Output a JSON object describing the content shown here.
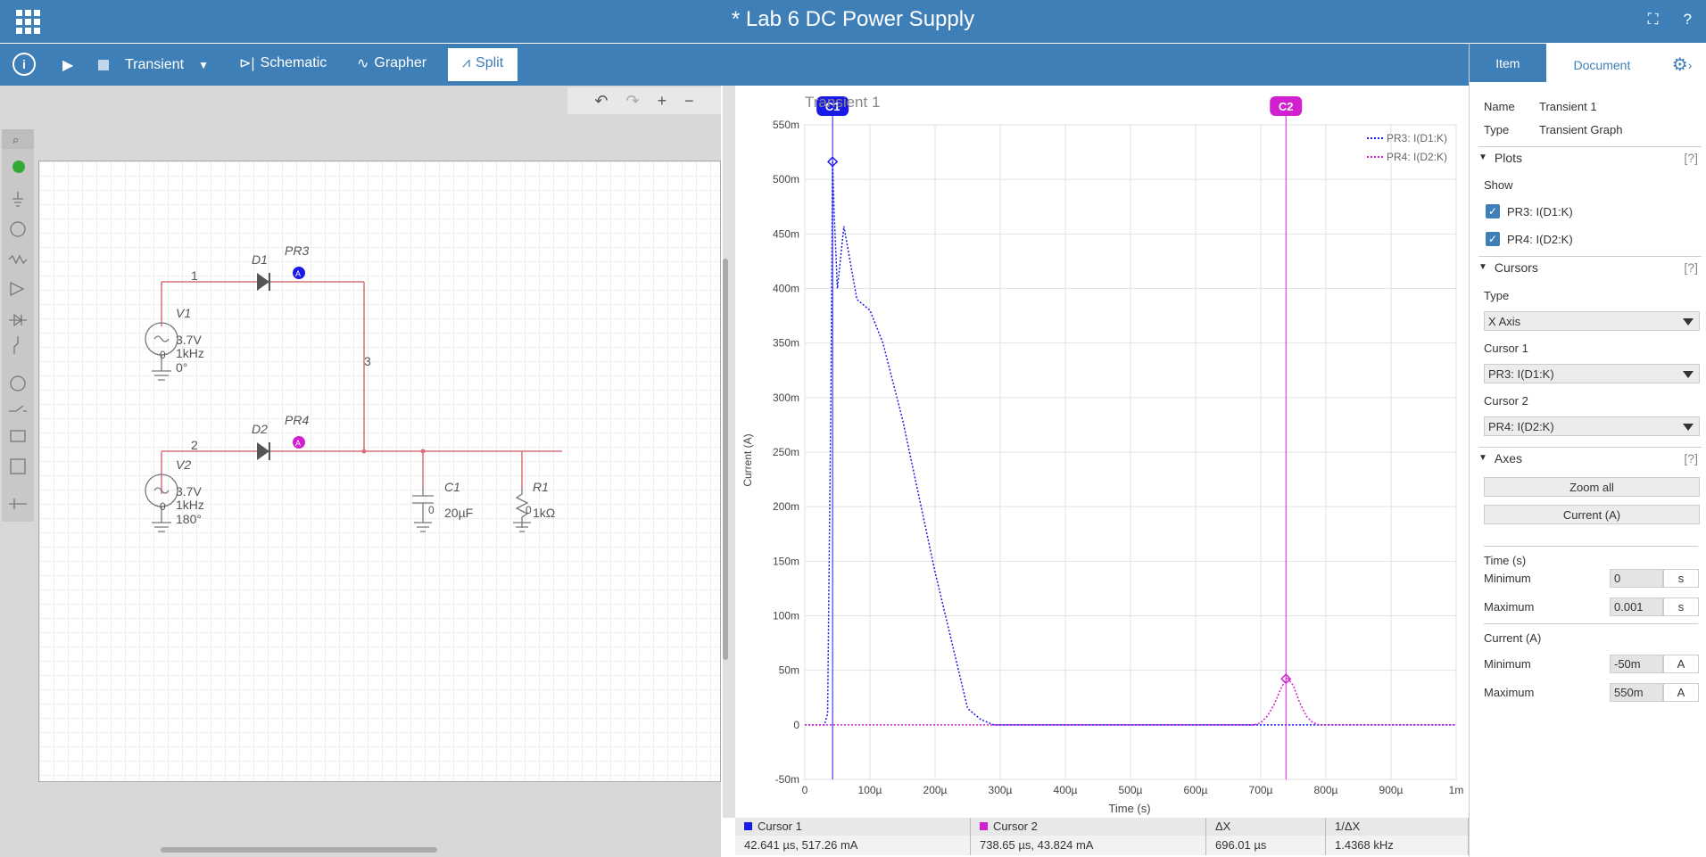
{
  "app": {
    "title": "* Lab 6 DC Power Supply"
  },
  "toolbar": {
    "mode": "Transient",
    "tabs": [
      "Schematic",
      "Grapher",
      "Split"
    ]
  },
  "panel": {
    "tabs": [
      "Item",
      "Document"
    ],
    "name_label": "Name",
    "name_value": "Transient 1",
    "type_label": "Type",
    "type_value": "Transient Graph",
    "plots_title": "Plots",
    "help": "[?]",
    "show_label": "Show",
    "plots": [
      "PR3: I(D1:K)",
      "PR4: I(D2:K)"
    ],
    "cursors_title": "Cursors",
    "cursor_type_label": "Type",
    "cursor_type_value": "X Axis",
    "cursor1_label": "Cursor 1",
    "cursor1_value": "PR3: I(D1:K)",
    "cursor2_label": "Cursor 2",
    "cursor2_value": "PR4: I(D2:K)",
    "axes_title": "Axes",
    "zoom_all": "Zoom all",
    "current_axis_btn": "Current (A)",
    "time_title": "Time (s)",
    "time_min_label": "Minimum",
    "time_min": "0",
    "time_max_label": "Maximum",
    "time_max": "0.001",
    "time_unit": "s",
    "current_title": "Current (A)",
    "cur_min_label": "Minimum",
    "cur_min": "-50m",
    "cur_max_label": "Maximum",
    "cur_max": "550m",
    "cur_unit": "A"
  },
  "schematic": {
    "labels": [
      "1",
      "2",
      "3",
      "D1",
      "D2",
      "PR3",
      "PR4",
      "V1",
      "V2",
      "C1",
      "R1",
      "3.7V",
      "1kHz",
      "0°",
      "3.7V",
      "1kHz",
      "180°",
      "20µF",
      "1kΩ",
      "0",
      "0",
      "0",
      "0"
    ]
  },
  "chart_data": {
    "type": "line",
    "title": "Transient 1",
    "xlabel": "Time (s)",
    "ylabel": "Current (A)",
    "xlim": [
      0,
      0.001
    ],
    "ylim": [
      -0.05,
      0.55
    ],
    "x_ticks": [
      "0",
      "100µ",
      "200µ",
      "300µ",
      "400µ",
      "500µ",
      "600µ",
      "700µ",
      "800µ",
      "900µ",
      "1m"
    ],
    "y_ticks": [
      "-50m",
      "0",
      "50m",
      "100m",
      "150m",
      "200m",
      "250m",
      "300m",
      "350m",
      "400m",
      "450m",
      "500m",
      "550m"
    ],
    "grid": true,
    "legend": "top-right",
    "series": [
      {
        "name": "PR3: I(D1:K)",
        "color": "#1a1ae6",
        "x": [
          0,
          3e-05,
          3.5e-05,
          4e-05,
          4.26e-05,
          4.5e-05,
          5e-05,
          6e-05,
          8e-05,
          0.0001,
          0.00012,
          0.00015,
          0.0002,
          0.00025,
          0.00027,
          0.00029,
          0.0003,
          0.001
        ],
        "y": [
          0,
          0,
          0.01,
          0.3,
          0.517,
          0.47,
          0.4,
          0.457,
          0.39,
          0.38,
          0.35,
          0.28,
          0.14,
          0.015,
          0.005,
          0,
          0,
          0
        ]
      },
      {
        "name": "PR4: I(D2:K)",
        "color": "#d020d0",
        "x": [
          0,
          0.00069,
          0.0007,
          0.00071,
          0.00072,
          0.00073,
          0.00074,
          0.00075,
          0.00076,
          0.00077,
          0.00078,
          0.00079,
          0.001
        ],
        "y": [
          0,
          0,
          0.002,
          0.008,
          0.018,
          0.032,
          0.0438,
          0.036,
          0.02,
          0.008,
          0.002,
          0,
          0
        ]
      }
    ],
    "cursors": [
      {
        "label": "C1",
        "x": 4.2641e-05,
        "color": "#1a1ae6"
      },
      {
        "label": "C2",
        "x": 0.00073865,
        "color": "#d020d0"
      }
    ]
  },
  "readout": {
    "c1_head": "Cursor 1",
    "c2_head": "Cursor 2",
    "dx_head": "ΔX",
    "inv_head": "1/ΔX",
    "c1_val": "42.641 µs, 517.26 mA",
    "c2_val": "738.65 µs, 43.824 mA",
    "dx_val": "696.01 µs",
    "inv_val": "1.4368 kHz"
  },
  "colors": {
    "brand": "#3f7fb8",
    "wire": "#d9707a",
    "c1": "#1a1ae6",
    "c2": "#d020d0"
  },
  "icons": [
    "apps-grid-icon",
    "fullscreen-icon",
    "help-icon",
    "info-icon",
    "play-icon",
    "stop-icon",
    "dropdown-icon",
    "gear-icon",
    "chevron-right-icon",
    "undo-icon",
    "redo-icon",
    "zoom-in-icon",
    "zoom-out-icon"
  ]
}
